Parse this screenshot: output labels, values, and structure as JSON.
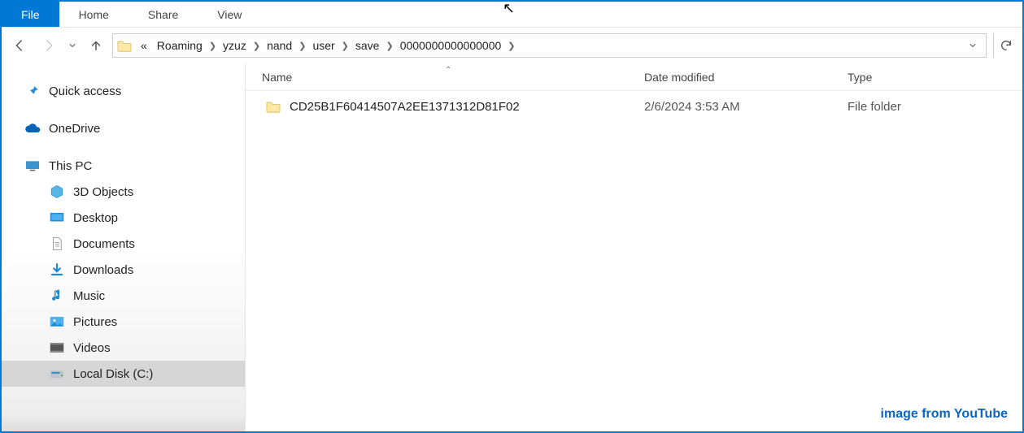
{
  "ribbon": {
    "tabs": [
      {
        "label": "File",
        "active": true
      },
      {
        "label": "Home",
        "active": false
      },
      {
        "label": "Share",
        "active": false
      },
      {
        "label": "View",
        "active": false
      }
    ]
  },
  "breadcrumb": {
    "overflow_label": "«",
    "items": [
      "Roaming",
      "yzuz",
      "nand",
      "user",
      "save",
      "0000000000000000"
    ]
  },
  "columns": {
    "name": "Name",
    "date": "Date modified",
    "type": "Type"
  },
  "files": [
    {
      "name": "CD25B1F60414507A2EE1371312D81F02",
      "date": "2/6/2024 3:53 AM",
      "type": "File folder"
    }
  ],
  "sidebar": {
    "quick_access": "Quick access",
    "onedrive": "OneDrive",
    "this_pc": "This PC",
    "children": [
      {
        "label": "3D Objects",
        "icon": "cube"
      },
      {
        "label": "Desktop",
        "icon": "desktop"
      },
      {
        "label": "Documents",
        "icon": "doc"
      },
      {
        "label": "Downloads",
        "icon": "download"
      },
      {
        "label": "Music",
        "icon": "music"
      },
      {
        "label": "Pictures",
        "icon": "pictures"
      },
      {
        "label": "Videos",
        "icon": "videos"
      },
      {
        "label": "Local Disk (C:)",
        "icon": "disk",
        "selected": true
      }
    ]
  },
  "watermark": "image from YouTube"
}
